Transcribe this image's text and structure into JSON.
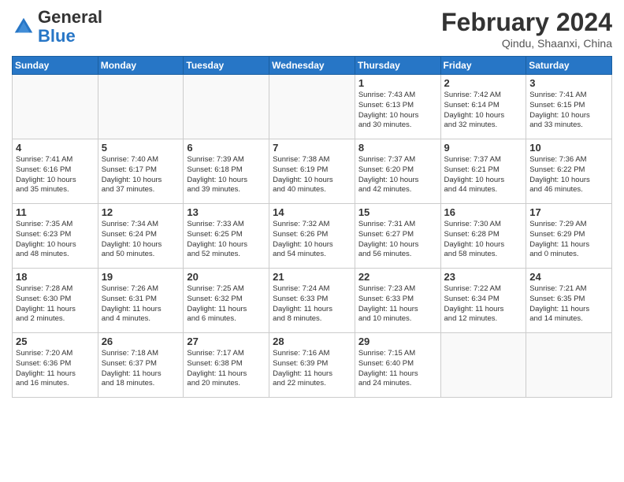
{
  "header": {
    "logo_general": "General",
    "logo_blue": "Blue",
    "month_title": "February 2024",
    "location": "Qindu, Shaanxi, China"
  },
  "weekdays": [
    "Sunday",
    "Monday",
    "Tuesday",
    "Wednesday",
    "Thursday",
    "Friday",
    "Saturday"
  ],
  "weeks": [
    [
      {
        "day": "",
        "info": ""
      },
      {
        "day": "",
        "info": ""
      },
      {
        "day": "",
        "info": ""
      },
      {
        "day": "",
        "info": ""
      },
      {
        "day": "1",
        "info": "Sunrise: 7:43 AM\nSunset: 6:13 PM\nDaylight: 10 hours\nand 30 minutes."
      },
      {
        "day": "2",
        "info": "Sunrise: 7:42 AM\nSunset: 6:14 PM\nDaylight: 10 hours\nand 32 minutes."
      },
      {
        "day": "3",
        "info": "Sunrise: 7:41 AM\nSunset: 6:15 PM\nDaylight: 10 hours\nand 33 minutes."
      }
    ],
    [
      {
        "day": "4",
        "info": "Sunrise: 7:41 AM\nSunset: 6:16 PM\nDaylight: 10 hours\nand 35 minutes."
      },
      {
        "day": "5",
        "info": "Sunrise: 7:40 AM\nSunset: 6:17 PM\nDaylight: 10 hours\nand 37 minutes."
      },
      {
        "day": "6",
        "info": "Sunrise: 7:39 AM\nSunset: 6:18 PM\nDaylight: 10 hours\nand 39 minutes."
      },
      {
        "day": "7",
        "info": "Sunrise: 7:38 AM\nSunset: 6:19 PM\nDaylight: 10 hours\nand 40 minutes."
      },
      {
        "day": "8",
        "info": "Sunrise: 7:37 AM\nSunset: 6:20 PM\nDaylight: 10 hours\nand 42 minutes."
      },
      {
        "day": "9",
        "info": "Sunrise: 7:37 AM\nSunset: 6:21 PM\nDaylight: 10 hours\nand 44 minutes."
      },
      {
        "day": "10",
        "info": "Sunrise: 7:36 AM\nSunset: 6:22 PM\nDaylight: 10 hours\nand 46 minutes."
      }
    ],
    [
      {
        "day": "11",
        "info": "Sunrise: 7:35 AM\nSunset: 6:23 PM\nDaylight: 10 hours\nand 48 minutes."
      },
      {
        "day": "12",
        "info": "Sunrise: 7:34 AM\nSunset: 6:24 PM\nDaylight: 10 hours\nand 50 minutes."
      },
      {
        "day": "13",
        "info": "Sunrise: 7:33 AM\nSunset: 6:25 PM\nDaylight: 10 hours\nand 52 minutes."
      },
      {
        "day": "14",
        "info": "Sunrise: 7:32 AM\nSunset: 6:26 PM\nDaylight: 10 hours\nand 54 minutes."
      },
      {
        "day": "15",
        "info": "Sunrise: 7:31 AM\nSunset: 6:27 PM\nDaylight: 10 hours\nand 56 minutes."
      },
      {
        "day": "16",
        "info": "Sunrise: 7:30 AM\nSunset: 6:28 PM\nDaylight: 10 hours\nand 58 minutes."
      },
      {
        "day": "17",
        "info": "Sunrise: 7:29 AM\nSunset: 6:29 PM\nDaylight: 11 hours\nand 0 minutes."
      }
    ],
    [
      {
        "day": "18",
        "info": "Sunrise: 7:28 AM\nSunset: 6:30 PM\nDaylight: 11 hours\nand 2 minutes."
      },
      {
        "day": "19",
        "info": "Sunrise: 7:26 AM\nSunset: 6:31 PM\nDaylight: 11 hours\nand 4 minutes."
      },
      {
        "day": "20",
        "info": "Sunrise: 7:25 AM\nSunset: 6:32 PM\nDaylight: 11 hours\nand 6 minutes."
      },
      {
        "day": "21",
        "info": "Sunrise: 7:24 AM\nSunset: 6:33 PM\nDaylight: 11 hours\nand 8 minutes."
      },
      {
        "day": "22",
        "info": "Sunrise: 7:23 AM\nSunset: 6:33 PM\nDaylight: 11 hours\nand 10 minutes."
      },
      {
        "day": "23",
        "info": "Sunrise: 7:22 AM\nSunset: 6:34 PM\nDaylight: 11 hours\nand 12 minutes."
      },
      {
        "day": "24",
        "info": "Sunrise: 7:21 AM\nSunset: 6:35 PM\nDaylight: 11 hours\nand 14 minutes."
      }
    ],
    [
      {
        "day": "25",
        "info": "Sunrise: 7:20 AM\nSunset: 6:36 PM\nDaylight: 11 hours\nand 16 minutes."
      },
      {
        "day": "26",
        "info": "Sunrise: 7:18 AM\nSunset: 6:37 PM\nDaylight: 11 hours\nand 18 minutes."
      },
      {
        "day": "27",
        "info": "Sunrise: 7:17 AM\nSunset: 6:38 PM\nDaylight: 11 hours\nand 20 minutes."
      },
      {
        "day": "28",
        "info": "Sunrise: 7:16 AM\nSunset: 6:39 PM\nDaylight: 11 hours\nand 22 minutes."
      },
      {
        "day": "29",
        "info": "Sunrise: 7:15 AM\nSunset: 6:40 PM\nDaylight: 11 hours\nand 24 minutes."
      },
      {
        "day": "",
        "info": ""
      },
      {
        "day": "",
        "info": ""
      }
    ]
  ]
}
